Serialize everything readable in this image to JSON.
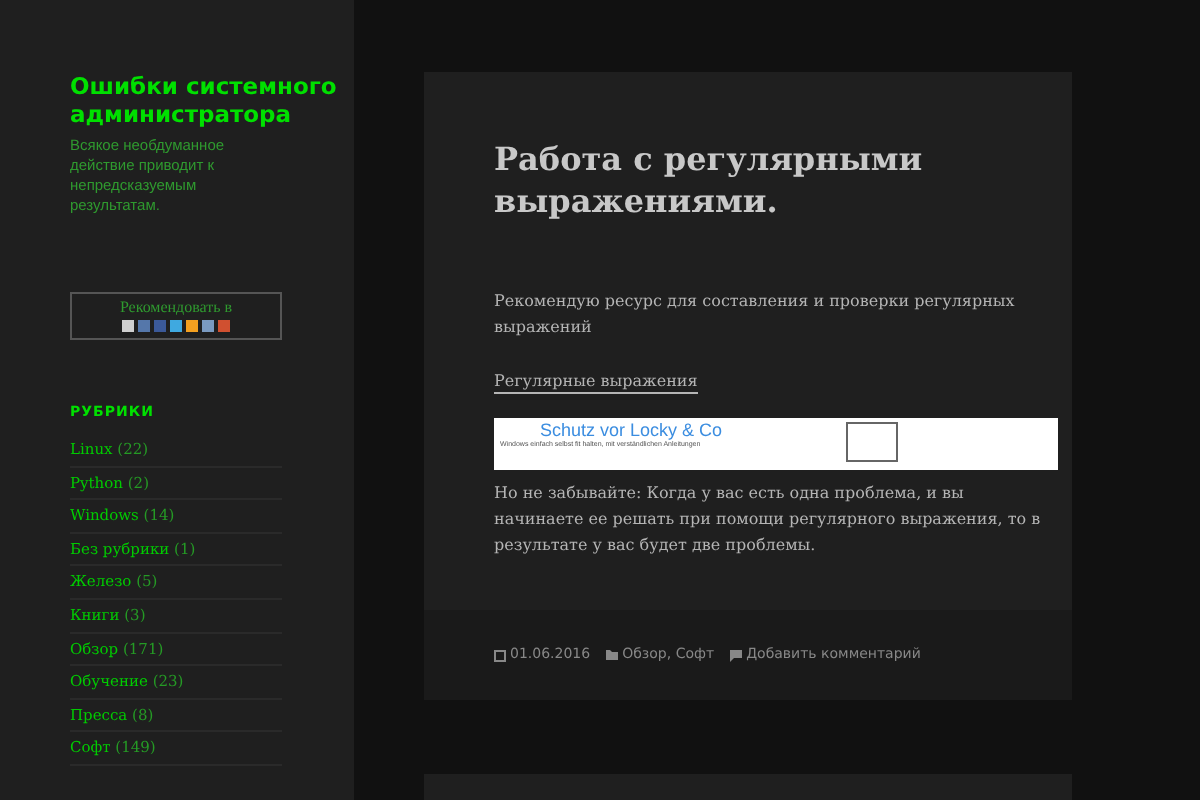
{
  "site": {
    "title": "Ошибки системного администратора",
    "tagline": "Всякое необдуманное действие приводит к непредсказуемым результатам."
  },
  "share": {
    "label": "Рекомендовать в",
    "icons": [
      {
        "color": "#d0d0d0"
      },
      {
        "color": "#5577aa"
      },
      {
        "color": "#3b5998"
      },
      {
        "color": "#3fa9e0"
      },
      {
        "color": "#f4a020"
      },
      {
        "color": "#7a9ac0"
      },
      {
        "color": "#d05030"
      }
    ]
  },
  "categories": {
    "heading": "РУБРИКИ",
    "items": [
      {
        "name": "Linux",
        "count": "(22)"
      },
      {
        "name": "Python",
        "count": "(2)"
      },
      {
        "name": "Windows",
        "count": "(14)"
      },
      {
        "name": "Без рубрики",
        "count": "(1)"
      },
      {
        "name": "Железо",
        "count": "(5)"
      },
      {
        "name": "Книги",
        "count": "(3)"
      },
      {
        "name": "Обзор",
        "count": "(171)"
      },
      {
        "name": "Обучение",
        "count": "(23)"
      },
      {
        "name": "Пресса",
        "count": "(8)"
      },
      {
        "name": "Софт",
        "count": "(149)"
      }
    ]
  },
  "post": {
    "title": "Работа с регулярными выражениями.",
    "intro": "Рекомендую ресурс для составления и проверки регулярных выражений",
    "link": "Регулярные выражения",
    "ad": {
      "headline": "Schutz vor Locky & Co",
      "text": "Windows einfach selbst fit halten, mit verständlichen Anleitungen"
    },
    "body": "Но не забывайте: Когда у вас есть одна проблема, и вы начинаете ее решать при помощи регулярного выражения, то в результате у вас будет две проблемы.",
    "meta": {
      "date": "01.06.2016",
      "categories": "Обзор, Софт",
      "comments": "Добавить комментарий"
    }
  }
}
